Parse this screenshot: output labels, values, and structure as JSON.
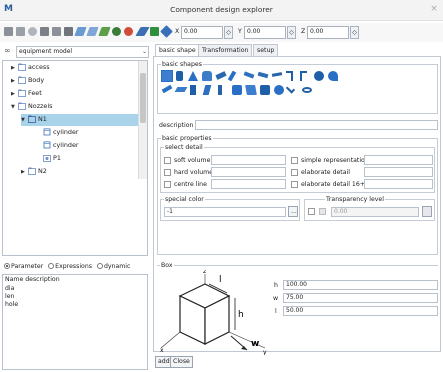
{
  "window": {
    "title": "Component design explorer",
    "logo": "M",
    "close": "×"
  },
  "toolbar": {
    "x_label": "X",
    "x_value": "0.00",
    "y_label": "Y",
    "y_value": "0.00",
    "z_label": "Z",
    "z_value": "0.00",
    "spin_glyph": "◇"
  },
  "left": {
    "model_select": "equipment model",
    "tree": [
      {
        "label": "access",
        "state": "collapsed",
        "depth": 1
      },
      {
        "label": "Body",
        "state": "collapsed",
        "depth": 1
      },
      {
        "label": "Feet",
        "state": "collapsed",
        "depth": 1
      },
      {
        "label": "Nozzels",
        "state": "expanded",
        "depth": 1
      },
      {
        "label": "N1",
        "state": "expanded",
        "depth": 2,
        "selected": true
      },
      {
        "label": "cylinder",
        "depth": 3
      },
      {
        "label": "cylinder",
        "depth": 3
      },
      {
        "label": "P1",
        "depth": 3
      },
      {
        "label": "N2",
        "state": "collapsed",
        "depth": 2
      }
    ],
    "modes": {
      "parameter": "Parameter",
      "expressions": "Expressions",
      "dynamic": "dynamic"
    },
    "params_header": "Name  description",
    "params": [
      "dia",
      "len",
      "hole"
    ]
  },
  "tabs": {
    "basic_shape": "basic shape",
    "transformation": "Transformation",
    "setup": "setup"
  },
  "basic_shapes_title": "basic shapes",
  "description_label": "description",
  "basic_properties_title": "basic properties",
  "select_detail_title": "select detail",
  "details": {
    "soft_volume": "soft volume",
    "hard_volume": "hard volume",
    "centre_line": "centre line",
    "simple_representation": "simple representation",
    "elaborate_detail": "elaborate detail",
    "elaborate_detail_16": "elaborate detail 16+"
  },
  "special_color_title": "special color",
  "special_color_value": "-1",
  "special_color_btn": "...",
  "transparency_title": "Transparency level",
  "transparency_value": "0.00",
  "box_title": "Box",
  "box": {
    "h_label": "h",
    "h_value": "100.00",
    "w_label": "w",
    "w_value": "75.00",
    "l_label": "l",
    "l_value": "50.00"
  },
  "diagram": {
    "z": "z",
    "x": "x",
    "y": "y",
    "l": "l",
    "h": "h",
    "w": "w"
  },
  "buttons": {
    "add": "add",
    "close": "Close"
  },
  "colors": {
    "accent": "#2a6fc6",
    "selection": "#a8d3ea",
    "folder": "#6b8bc3"
  }
}
